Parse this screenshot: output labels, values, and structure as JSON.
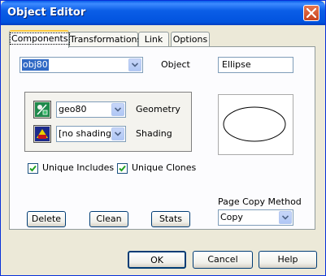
{
  "window": {
    "title": "Object Editor"
  },
  "tabs": [
    {
      "label": "Components",
      "active": true
    },
    {
      "label": "Transformations",
      "active": false
    },
    {
      "label": "Link",
      "active": false
    },
    {
      "label": "Options",
      "active": false
    }
  ],
  "object": {
    "name_value": "obj80",
    "label": "Object",
    "type_value": "Ellipse"
  },
  "geometry": {
    "value": "geo80",
    "label": "Geometry",
    "icon": "geometry-icon"
  },
  "shading": {
    "value": "[no shading]",
    "label": "Shading",
    "icon": "shading-icon"
  },
  "options": {
    "unique_includes": {
      "label": "Unique Includes",
      "checked": true
    },
    "unique_clones": {
      "label": "Unique Clones",
      "checked": true
    }
  },
  "actions": {
    "delete": "Delete",
    "clean": "Clean",
    "stats": "Stats"
  },
  "page_copy": {
    "label": "Page Copy Method",
    "value": "Copy"
  },
  "footer": {
    "ok": "OK",
    "cancel": "Cancel",
    "help": "Help"
  },
  "colors": {
    "titlebar": "#0153de",
    "face": "#ece9d8",
    "selection": "#316ac5",
    "close": "#c8441f"
  }
}
